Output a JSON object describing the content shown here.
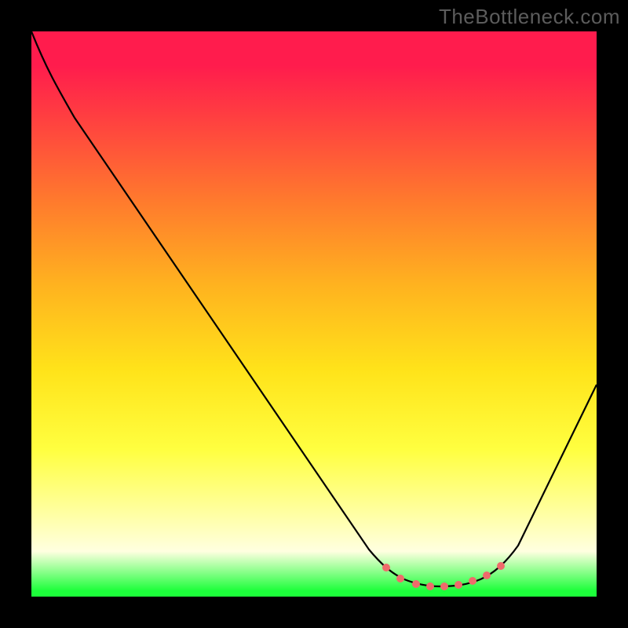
{
  "watermark": "TheBottleneck.com",
  "chart_data": {
    "type": "line",
    "title": "",
    "xlabel": "",
    "ylabel": "",
    "xlim": [
      0,
      100
    ],
    "ylim": [
      0,
      100
    ],
    "series": [
      {
        "name": "bottleneck-curve",
        "x": [
          0,
          4,
          10,
          20,
          30,
          40,
          50,
          58,
          62,
          66,
          70,
          74,
          78,
          82,
          86,
          90,
          94,
          100
        ],
        "y": [
          100,
          92,
          84,
          70,
          56,
          42,
          28,
          15,
          8,
          3,
          1,
          0,
          0,
          1,
          5,
          14,
          26,
          48
        ]
      }
    ],
    "valley_markers_x": [
      63,
      66,
      69,
      72,
      75,
      78,
      81,
      84
    ],
    "gradient_stops": [
      {
        "pos": 0,
        "color": "#ff1c4d"
      },
      {
        "pos": 30,
        "color": "#ff7a2d"
      },
      {
        "pos": 60,
        "color": "#ffe31a"
      },
      {
        "pos": 92,
        "color": "#ffffe0"
      },
      {
        "pos": 100,
        "color": "#1cff3a"
      }
    ]
  }
}
